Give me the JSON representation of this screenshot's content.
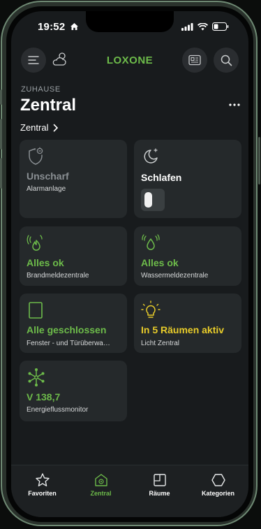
{
  "status": {
    "time": "19:52"
  },
  "header": {
    "logo": "LOXONE",
    "crumb": "ZUHAUSE",
    "title": "Zentral",
    "sub": "Zentral"
  },
  "colors": {
    "accent": "#6dbb4a",
    "yellow": "#e8cc2a",
    "muted": "#8a8f93"
  },
  "tiles": [
    {
      "value": "Unscharf",
      "label": "Alarmanlage",
      "icon": "shield-icon"
    },
    {
      "value": "Schlafen",
      "label": "",
      "icon": "moon-icon"
    },
    {
      "value": "Alles ok",
      "label": "Brandmeldezentrale",
      "icon": "fire-alarm-icon"
    },
    {
      "value": "Alles ok",
      "label": "Wassermeldezentrale",
      "icon": "water-alarm-icon"
    },
    {
      "value": "Alle geschlossen",
      "label": "Fenster - und Türüberwa…",
      "icon": "window-icon"
    },
    {
      "value": "In 5 Räumen aktiv",
      "label": "Licht Zentral",
      "icon": "lightbulb-icon"
    },
    {
      "value": "V 138,7",
      "label": "Energieflussmonitor",
      "icon": "energy-icon"
    }
  ],
  "tabs": [
    {
      "label": "Favoriten",
      "icon": "star-icon"
    },
    {
      "label": "Zentral",
      "icon": "home-icon"
    },
    {
      "label": "Räume",
      "icon": "room-icon"
    },
    {
      "label": "Kategorien",
      "icon": "hexagon-icon"
    }
  ]
}
